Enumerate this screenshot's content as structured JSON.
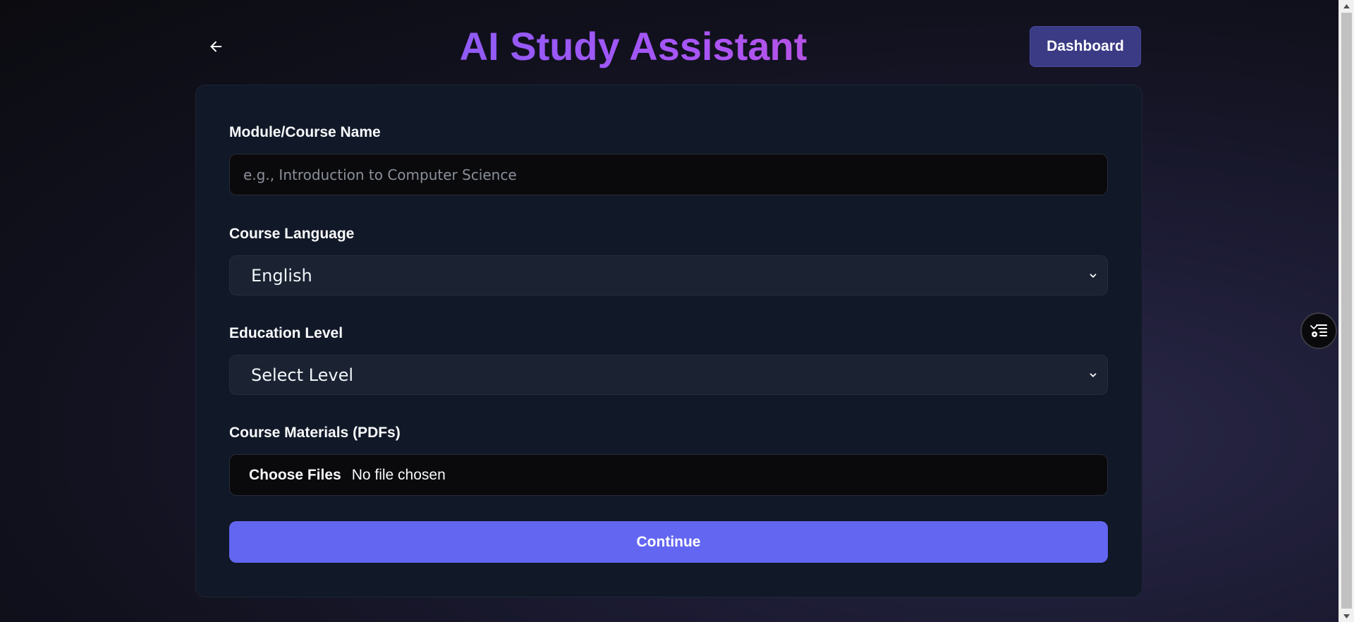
{
  "header": {
    "title": "AI Study Assistant",
    "dashboard_label": "Dashboard",
    "back_icon": "arrow-left-icon"
  },
  "form": {
    "course_name": {
      "label": "Module/Course Name",
      "placeholder": "e.g., Introduction to Computer Science",
      "value": ""
    },
    "language": {
      "label": "Course Language",
      "selected": "English"
    },
    "education_level": {
      "label": "Education Level",
      "selected": "Select Level"
    },
    "materials": {
      "label": "Course Materials (PDFs)",
      "button_label": "Choose Files",
      "status": "No file chosen"
    },
    "submit_label": "Continue"
  },
  "floating_widget": {
    "icon": "list-settings-icon"
  },
  "colors": {
    "accent": "#6366f1",
    "title_gradient": [
      "#6366f1",
      "#a855f7",
      "#ec4899"
    ],
    "dashboard_button": "#3b3a84",
    "card_background": "#111827"
  }
}
